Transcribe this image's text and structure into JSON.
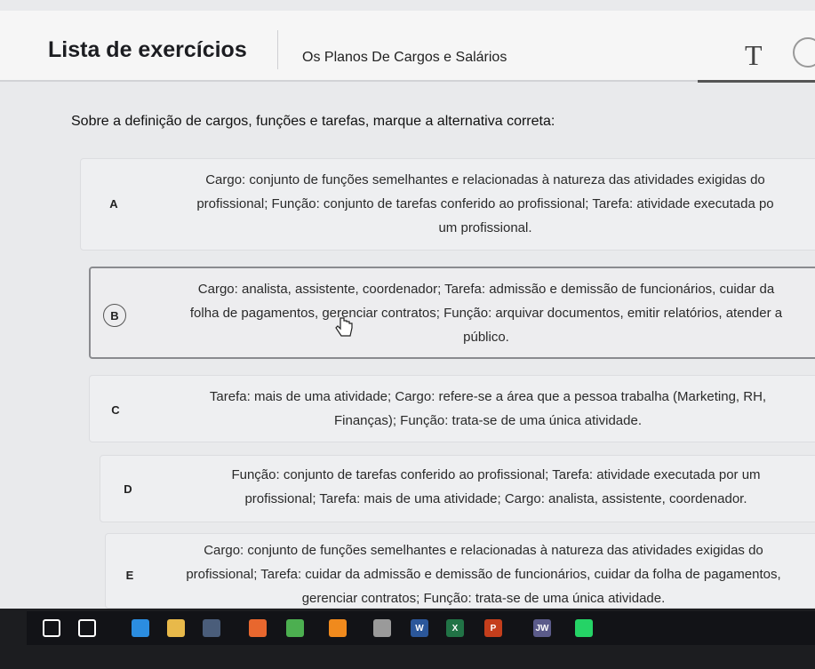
{
  "header": {
    "app_title": "Lista de exercícios",
    "subject": "Os Planos De Cargos e Salários",
    "font_button": "T"
  },
  "question": "Sobre a definição de cargos, funções e tarefas, marque a alternativa correta:",
  "options": [
    {
      "letter": "A",
      "lines": [
        "Cargo: conjunto de funções semelhantes e relacionadas à natureza das atividades exigidas do",
        "profissional; Função: conjunto de tarefas conferido ao profissional; Tarefa: atividade executada po",
        "um profissional."
      ]
    },
    {
      "letter": "B",
      "selected": true,
      "lines": [
        "Cargo: analista, assistente, coordenador; Tarefa: admissão e demissão de funcionários, cuidar da",
        "folha de pagamentos, gerenciar contratos; Função: arquivar documentos, emitir relatórios, atender a",
        "público."
      ]
    },
    {
      "letter": "C",
      "lines": [
        "Tarefa: mais de uma atividade; Cargo: refere-se a área que a pessoa trabalha (Marketing, RH,",
        "Finanças); Função: trata-se de uma única atividade."
      ]
    },
    {
      "letter": "D",
      "lines": [
        "Função: conjunto de tarefas conferido ao profissional; Tarefa: atividade executada por um",
        "profissional; Tarefa: mais de uma atividade; Cargo: analista, assistente, coordenador."
      ]
    },
    {
      "letter": "E",
      "lines": [
        "Cargo: conjunto de funções semelhantes e relacionadas à natureza das atividades exigidas do",
        "profissional; Tarefa: cuidar da admissão e demissão de funcionários, cuidar da folha de pagamentos,",
        "gerenciar contratos; Função: trata-se de uma única atividade."
      ]
    }
  ],
  "taskbar": {
    "icons": [
      {
        "name": "windows-start-icon",
        "label": "",
        "color": "#ffffff"
      },
      {
        "name": "task-view-icon",
        "label": "",
        "color": "#ffffff"
      },
      {
        "name": "edge-browser-icon",
        "label": "",
        "color": "#2b8de0"
      },
      {
        "name": "file-explorer-icon",
        "label": "",
        "color": "#e8b94a"
      },
      {
        "name": "store-icon",
        "label": "",
        "color": "#4a5d7a"
      },
      {
        "name": "firefox-icon",
        "label": "",
        "color": "#e8672e"
      },
      {
        "name": "chrome-icon",
        "label": "",
        "color": "#4caf50"
      },
      {
        "name": "vlc-icon",
        "label": "",
        "color": "#f08a1d"
      },
      {
        "name": "inkscape-icon",
        "label": "",
        "color": "#9a9a9a"
      },
      {
        "name": "word-icon",
        "label": "W",
        "color": "#2b579a"
      },
      {
        "name": "excel-icon",
        "label": "X",
        "color": "#217346"
      },
      {
        "name": "powerpoint-icon",
        "label": "P",
        "color": "#c43e1c"
      },
      {
        "name": "jw-library-icon",
        "label": "JW",
        "color": "#5b5b8a"
      },
      {
        "name": "whatsapp-icon",
        "label": "",
        "color": "#25d366"
      }
    ]
  }
}
